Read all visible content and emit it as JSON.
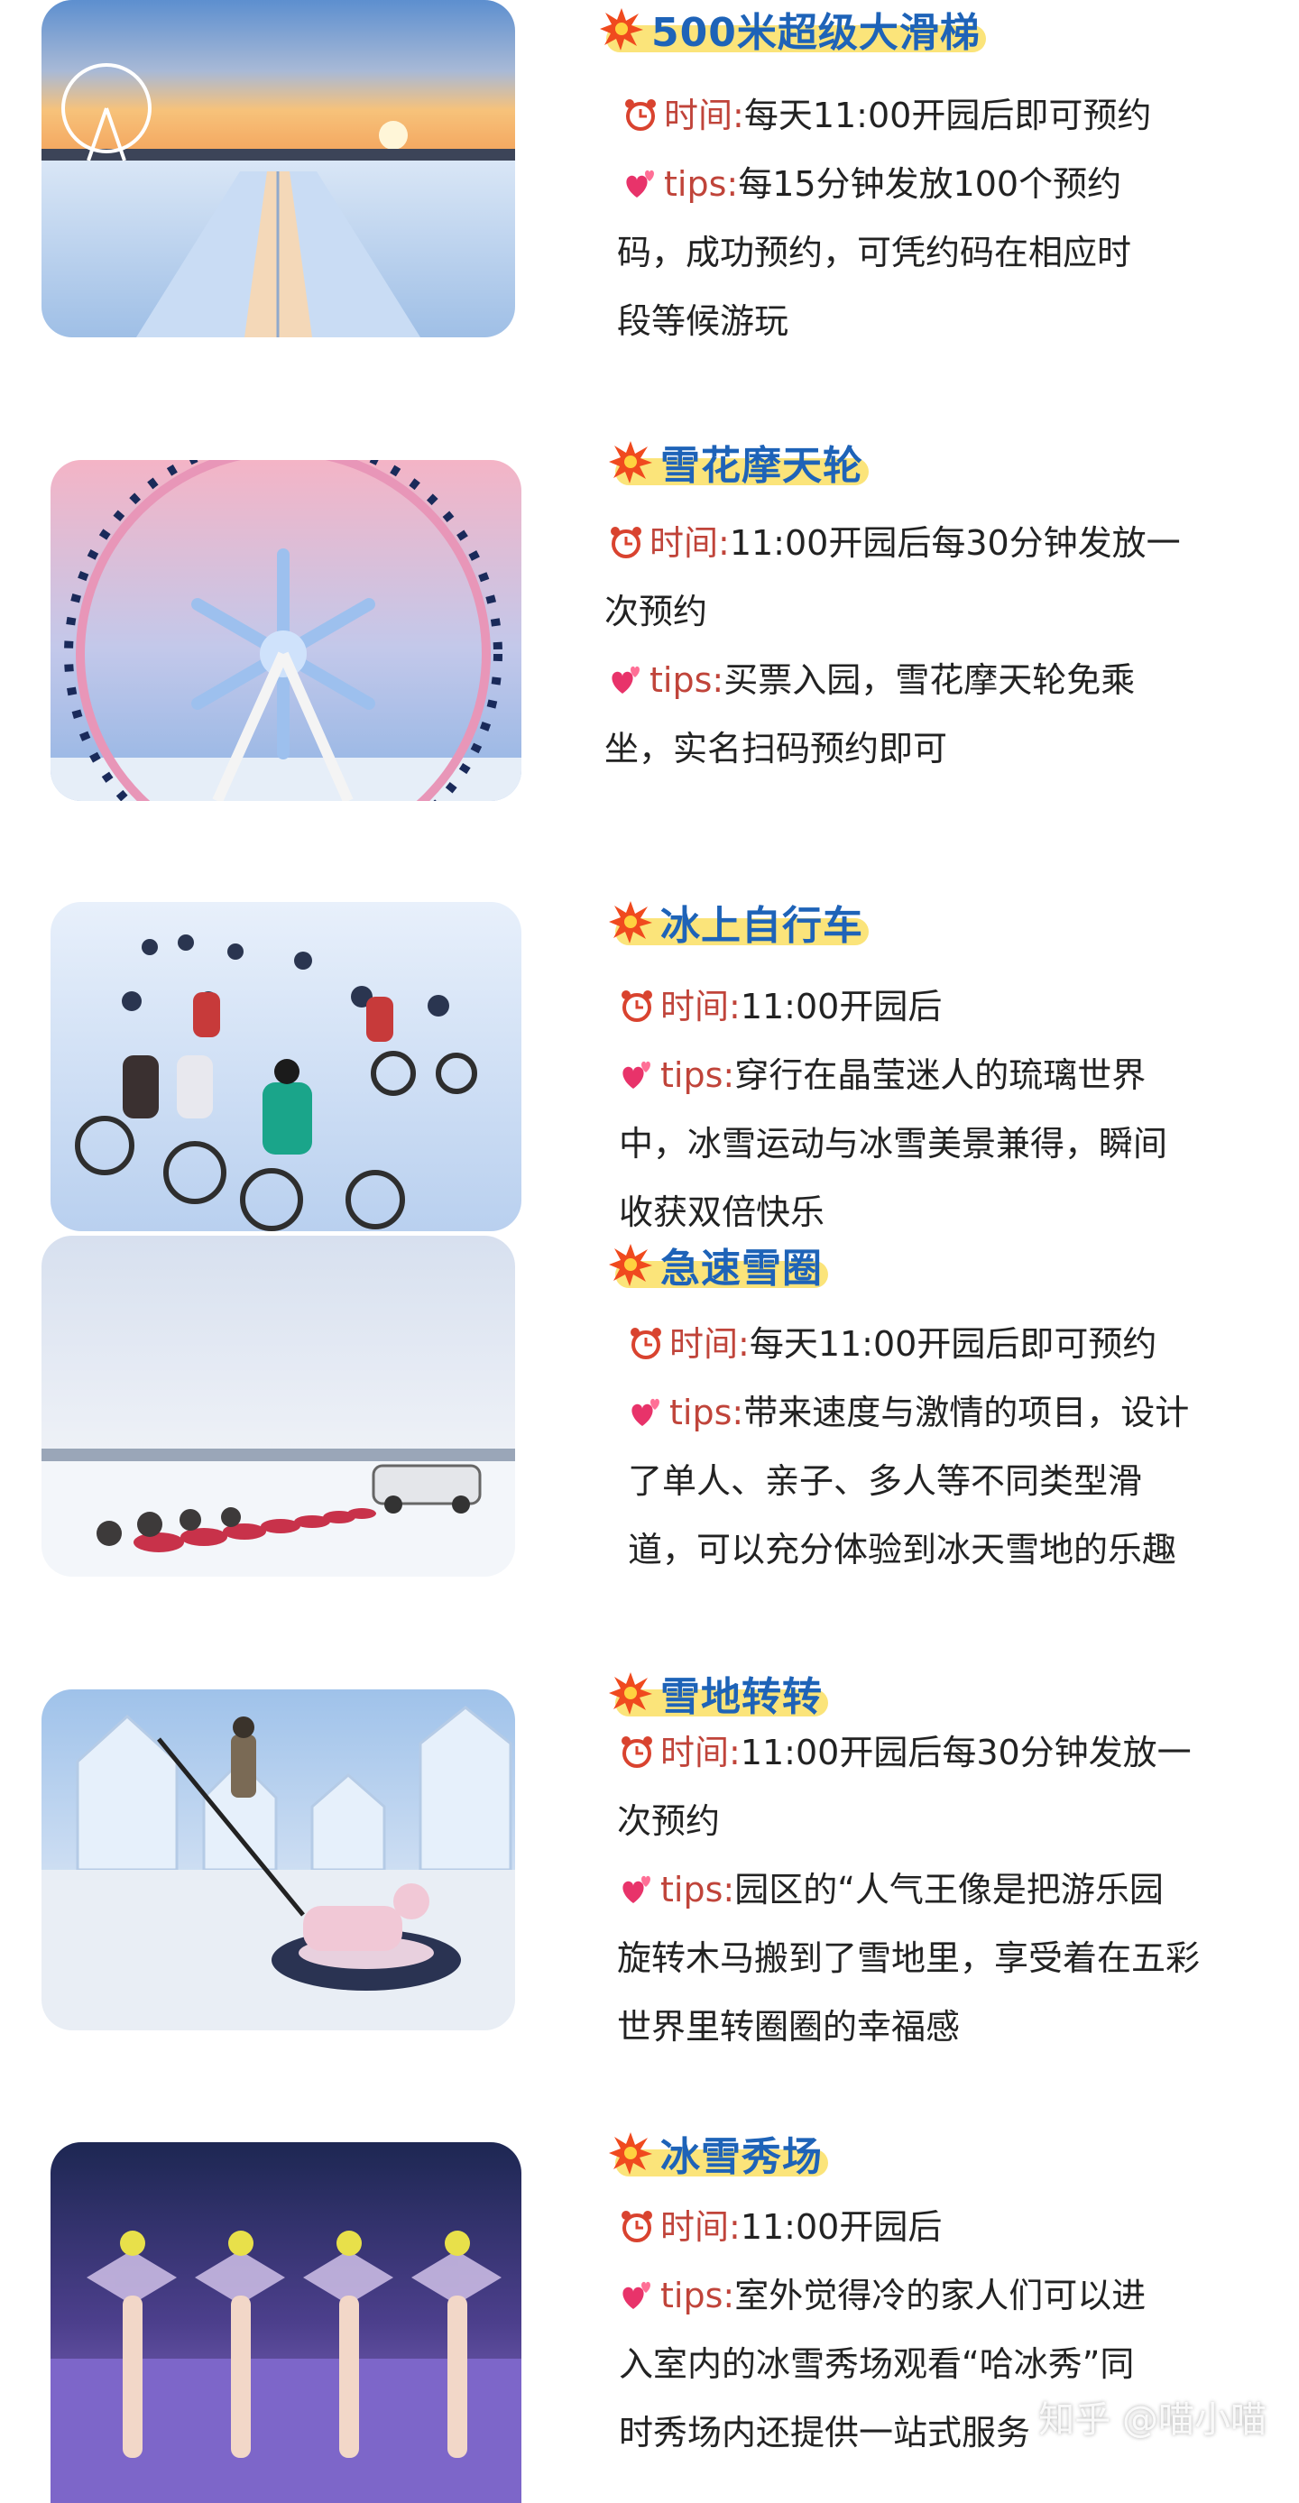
{
  "sections": [
    {
      "title": "500米超级大滑梯",
      "time_label": "时间:",
      "time_lines": [
        "每天11:00开园后即可预约"
      ],
      "tips_label": "tips:",
      "tips_lines": [
        "每15分钟发放100个预约",
        "码，成功预约，可凭约码在相应时",
        "段等候游玩"
      ],
      "image": "ice-slide-sunset-photo"
    },
    {
      "title": "雪花摩天轮",
      "time_label": "时间:",
      "time_lines": [
        "11:00开园后每30分钟发放一",
        "次预约"
      ],
      "tips_label": "tips:",
      "tips_lines": [
        "买票入园，雪花摩天轮免乘",
        "坐，实名扫码预约即可"
      ],
      "image": "snowflake-ferris-wheel-photo"
    },
    {
      "title": "冰上自行车",
      "time_label": "时间:",
      "time_lines": [
        "11:00开园后"
      ],
      "tips_label": "tips:",
      "tips_lines": [
        "穿行在晶莹迷人的琉璃世界",
        "中，冰雪运动与冰雪美景兼得，瞬间",
        "收获双倍快乐"
      ],
      "image": "ice-bicycles-photo"
    },
    {
      "title": "急速雪圈",
      "time_label": "时间:",
      "time_lines": [
        "每天11:00开园后即可预约"
      ],
      "tips_label": "tips:",
      "tips_lines": [
        "带来速度与激情的项目，设计",
        "了单人、亲子、多人等不同类型滑",
        "道，可以充分体验到冰天雪地的乐趣"
      ],
      "image": "snow-tube-train-photo"
    },
    {
      "title": "雪地转转",
      "time_label": "时间:",
      "time_lines": [
        "11:00开园后每30分钟发放一",
        "次预约"
      ],
      "tips_label": "tips:",
      "tips_lines": [
        "园区的“人气王像是把游乐园",
        "旋转木马搬到了雪地里，享受着在五彩",
        "世界里转圈圈的幸福感"
      ],
      "image": "snow-spin-tube-photo"
    },
    {
      "title": "冰雪秀场",
      "time_label": "时间:",
      "time_lines": [
        "11:00开园后"
      ],
      "tips_label": "tips:",
      "tips_lines": [
        "室外觉得冷的家人们可以进",
        "入室内的冰雪秀场观看“哈冰秀”同",
        "时秀场内还提供一站式服务"
      ],
      "image": "ice-show-stage-photo"
    }
  ],
  "watermark": "知乎 @喵小喵",
  "colors": {
    "title_text": "#1e63b8",
    "title_highlight": "#fbe47a",
    "label_text": "#c0443a",
    "body_text": "#222222",
    "burst": "#f04a1e"
  },
  "icons": {
    "title": "starburst-icon",
    "time": "alarm-clock-icon",
    "tips": "two-hearts-icon"
  }
}
